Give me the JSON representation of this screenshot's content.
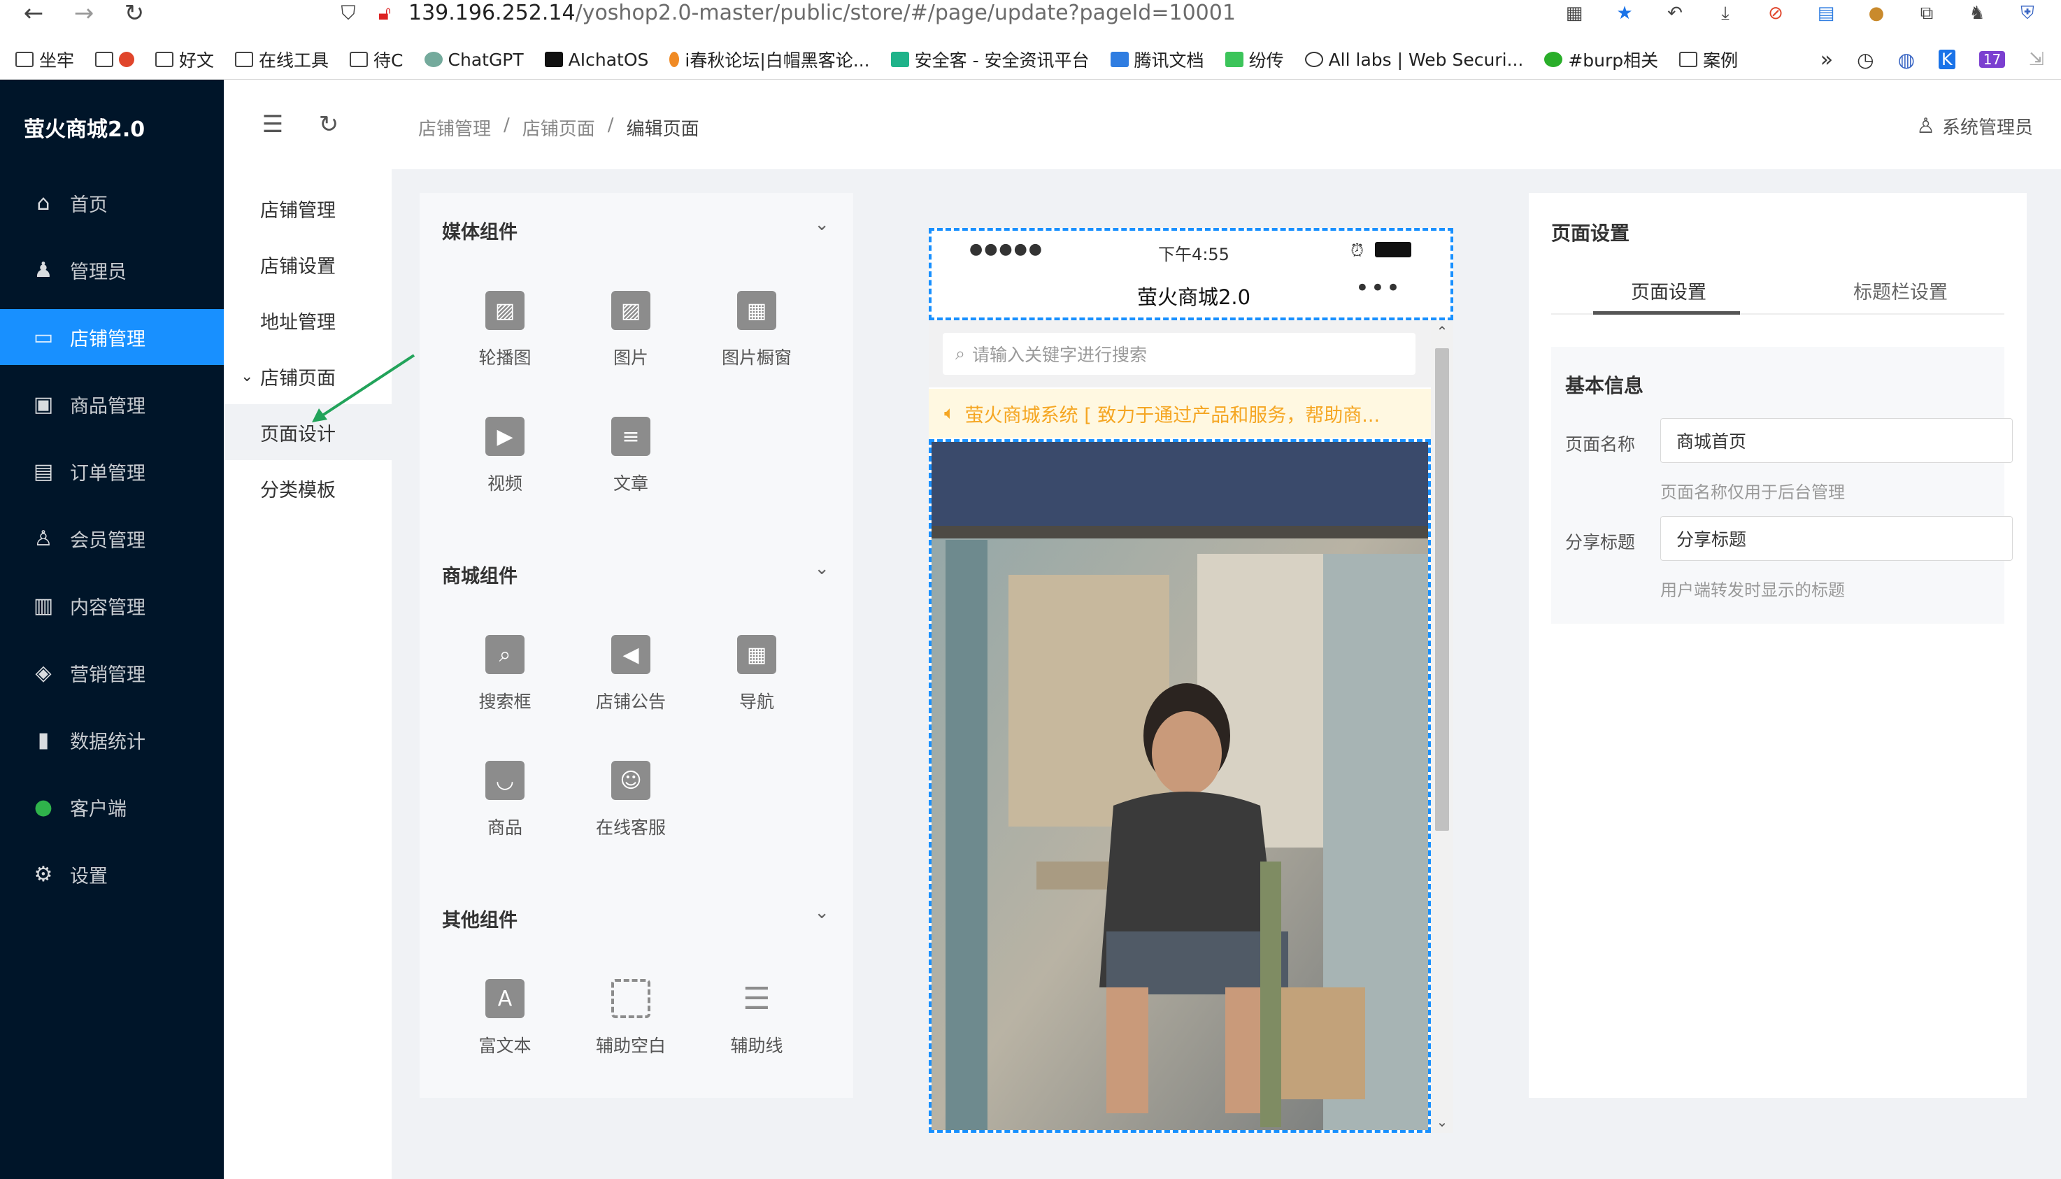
{
  "browser": {
    "url_host": "139.196.252.14",
    "url_path": "/yoshop2.0-master/public/store/#/page/update?pageId=10001",
    "bookmarks": [
      "坐牢",
      "",
      "好文",
      "在线工具",
      "待C",
      "ChatGPT",
      "AIchatOS",
      "i春秋论坛|白帽黑客论...",
      "安全客 - 安全资讯平台",
      "腾讯文档",
      "纷传",
      "All labs | Web Securi...",
      "#burp相关",
      "案例"
    ],
    "badge_count": "17"
  },
  "app": {
    "logo": "萤火商城2.0",
    "menu": [
      "首页",
      "管理员",
      "店铺管理",
      "商品管理",
      "订单管理",
      "会员管理",
      "内容管理",
      "营销管理",
      "数据统计",
      "客户端",
      "设置"
    ],
    "active_menu": "店铺管理"
  },
  "submenu": {
    "items": [
      "店铺管理",
      "店铺设置",
      "地址管理",
      "店铺页面",
      "页面设计",
      "分类模板"
    ],
    "active": "页面设计"
  },
  "header": {
    "breadcrumb": [
      "店铺管理",
      "/",
      "店铺页面",
      "/",
      "编辑页面"
    ],
    "user": "系统管理员"
  },
  "components": {
    "media_title": "媒体组件",
    "media": [
      "轮播图",
      "图片",
      "图片橱窗",
      "视频",
      "文章"
    ],
    "mall_title": "商城组件",
    "mall": [
      "搜索框",
      "店铺公告",
      "导航",
      "商品",
      "在线客服"
    ],
    "other_title": "其他组件",
    "other": [
      "富文本",
      "辅助空白",
      "辅助线"
    ]
  },
  "phone": {
    "time": "下午4:55",
    "signal": "●●●●●",
    "title": "萤火商城2.0",
    "more": "•••",
    "search_placeholder": "请输入关键字进行搜索",
    "notice": "萤火商城系统 [ 致力于通过产品和服务，帮助商..."
  },
  "settings": {
    "title": "页面设置",
    "tabs": [
      "页面设置",
      "标题栏设置"
    ],
    "active_tab": "页面设置",
    "section": "基本信息",
    "page_name_label": "页面名称",
    "page_name_value": "商城首页",
    "page_name_help": "页面名称仅用于后台管理",
    "share_title_label": "分享标题",
    "share_title_value": "分享标题",
    "share_title_help": "用户端转发时显示的标题"
  },
  "colors": {
    "sidebar_bg": "#001529",
    "accent": "#1890ff",
    "notice_text": "#f5a623",
    "arrow": "#22a35a"
  }
}
